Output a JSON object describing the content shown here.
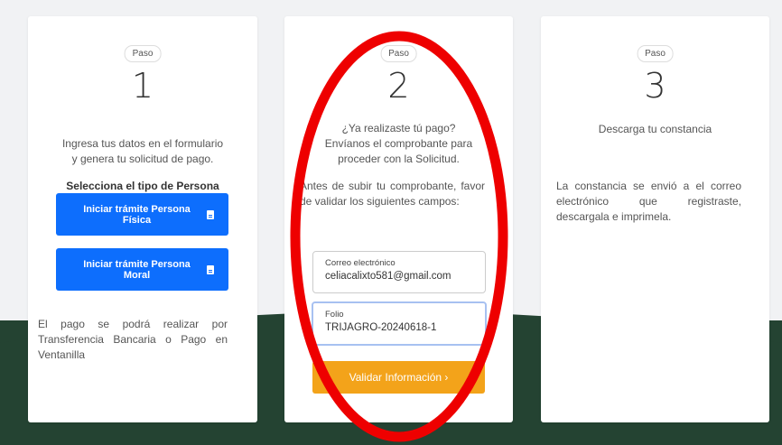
{
  "step_label": "Paso",
  "steps": [
    {
      "number": "1",
      "intro": [
        "Ingresa tus datos en el formulario",
        "y genera tu solicitud de pago."
      ],
      "select_title": "Selecciona el tipo de Persona",
      "btn_fisica": [
        "Iniciar trámite Persona",
        "Física"
      ],
      "btn_moral": [
        "Iniciar trámite Persona",
        "Moral"
      ],
      "note": "El pago se podrá realizar por Transferencia Bancaria o Pago en Ventanilla"
    },
    {
      "number": "2",
      "intro": [
        "¿Ya realizaste tú pago?",
        "Envíanos el comprobante para",
        "proceder con la Solicitud."
      ],
      "instructions": "Antes de subir tu comprobante, favor de validar los siguientes campos:",
      "email_label": "Correo electrónico",
      "email_value": "celiacalixto581@gmail.com",
      "folio_label": "Folio",
      "folio_value": "TRIJAGRO-20240618-1",
      "validate_label": "Validar Información  ›"
    },
    {
      "number": "3",
      "title": "Descarga tu constancia",
      "body": "La constancia se envió a el correo electrónico que registraste, descargala e imprimela."
    }
  ],
  "colors": {
    "primary": "#0d6efd",
    "accent": "#f3a31a",
    "footer": "#244332",
    "annotation": "#ee0000"
  }
}
